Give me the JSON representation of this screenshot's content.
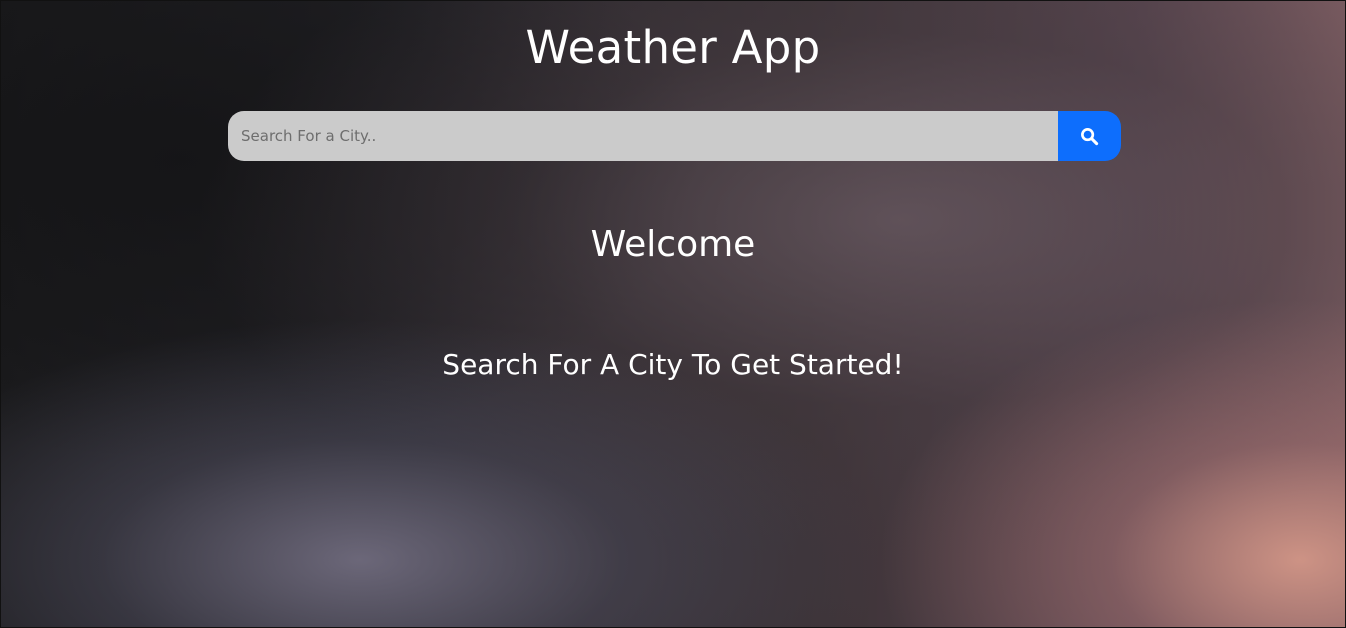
{
  "header": {
    "title": "Weather App"
  },
  "search": {
    "placeholder": "Search For a City..",
    "value": "",
    "button_icon": "search-icon"
  },
  "main": {
    "welcome": "Welcome",
    "prompt": "Search For A City To Get Started!"
  },
  "colors": {
    "accent": "#0d6efd",
    "input_background": "#cbcbcb",
    "text": "#ffffff"
  }
}
